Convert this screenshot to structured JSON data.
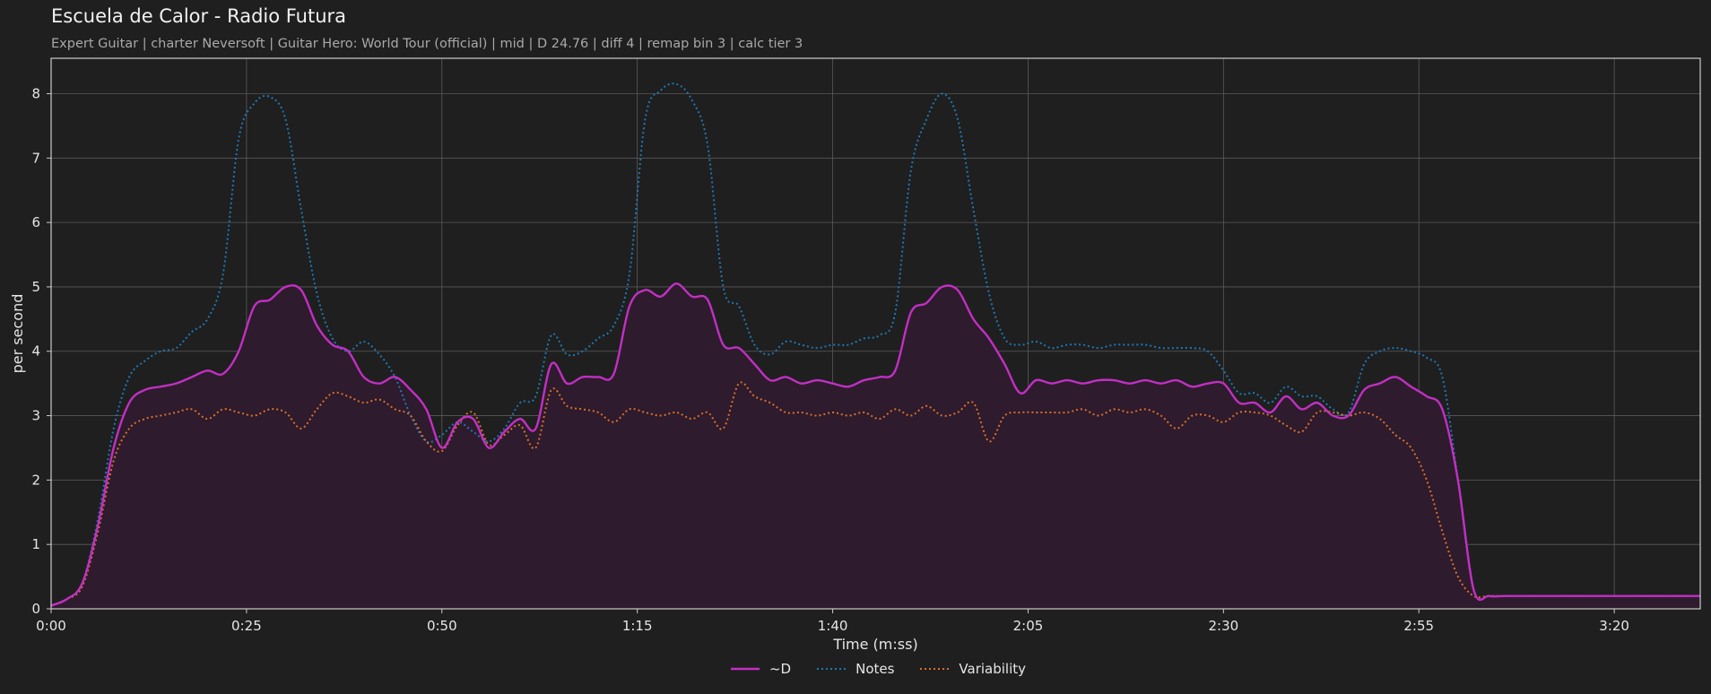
{
  "title": "Escuela de Calor - Radio Futura",
  "subtitle": "Expert Guitar  |  charter Neversoft  |  Guitar Hero: World Tour (official)  |  mid  |  D 24.76  |  diff 4  |  remap bin 3  |  calc tier 3",
  "colors": {
    "background": "#1f1f1f",
    "plot_border": "#cccccc",
    "grid": "#5a5a5a",
    "d_line": "#c22fc4",
    "d_fill": "#2e1b2d",
    "notes": "#1f77b4",
    "variability": "#d9702a"
  },
  "chart_data": {
    "type": "line",
    "xlabel": "Time (m:ss)",
    "ylabel": "per second",
    "xlim": [
      0,
      211
    ],
    "ylim": [
      0,
      8.55
    ],
    "x_ticks": [
      {
        "value": 0,
        "label": "0:00"
      },
      {
        "value": 25,
        "label": "0:25"
      },
      {
        "value": 50,
        "label": "0:50"
      },
      {
        "value": 75,
        "label": "1:15"
      },
      {
        "value": 100,
        "label": "1:40"
      },
      {
        "value": 125,
        "label": "2:05"
      },
      {
        "value": 150,
        "label": "2:30"
      },
      {
        "value": 175,
        "label": "2:55"
      },
      {
        "value": 200,
        "label": "3:20"
      }
    ],
    "y_ticks": [
      {
        "value": 0,
        "label": "0"
      },
      {
        "value": 1,
        "label": "1"
      },
      {
        "value": 2,
        "label": "2"
      },
      {
        "value": 3,
        "label": "3"
      },
      {
        "value": 4,
        "label": "4"
      },
      {
        "value": 5,
        "label": "5"
      },
      {
        "value": 6,
        "label": "6"
      },
      {
        "value": 7,
        "label": "7"
      },
      {
        "value": 8,
        "label": "8"
      }
    ],
    "grid": true,
    "legend_position": "bottom-center",
    "series": [
      {
        "name": "~D",
        "style": "solid",
        "filled": true,
        "x": [
          0,
          2,
          4,
          6,
          8,
          10,
          12,
          14,
          16,
          18,
          20,
          22,
          24,
          26,
          28,
          30,
          32,
          34,
          36,
          38,
          40,
          42,
          44,
          46,
          48,
          50,
          52,
          54,
          56,
          58,
          60,
          62,
          64,
          66,
          68,
          70,
          72,
          74,
          76,
          78,
          80,
          82,
          84,
          86,
          88,
          90,
          92,
          94,
          96,
          98,
          100,
          102,
          104,
          106,
          108,
          110,
          112,
          114,
          116,
          118,
          120,
          122,
          124,
          126,
          128,
          130,
          132,
          134,
          136,
          138,
          140,
          142,
          144,
          146,
          148,
          150,
          152,
          154,
          156,
          158,
          160,
          162,
          164,
          166,
          168,
          170,
          172,
          174,
          176,
          178,
          180,
          182,
          184,
          186,
          188,
          190,
          192,
          194,
          196,
          198,
          200,
          202,
          204,
          206,
          208,
          210,
          211
        ],
        "values": [
          0.05,
          0.15,
          0.4,
          1.3,
          2.5,
          3.2,
          3.4,
          3.45,
          3.5,
          3.6,
          3.7,
          3.65,
          4.0,
          4.7,
          4.8,
          5.0,
          4.95,
          4.4,
          4.1,
          4.0,
          3.6,
          3.5,
          3.6,
          3.4,
          3.1,
          2.5,
          2.9,
          2.95,
          2.5,
          2.75,
          2.95,
          2.8,
          3.8,
          3.5,
          3.6,
          3.6,
          3.65,
          4.7,
          4.95,
          4.85,
          5.05,
          4.85,
          4.8,
          4.1,
          4.05,
          3.8,
          3.55,
          3.6,
          3.5,
          3.55,
          3.5,
          3.45,
          3.55,
          3.6,
          3.7,
          4.6,
          4.75,
          5.0,
          4.95,
          4.5,
          4.2,
          3.8,
          3.35,
          3.55,
          3.5,
          3.55,
          3.5,
          3.55,
          3.55,
          3.5,
          3.55,
          3.5,
          3.55,
          3.45,
          3.5,
          3.5,
          3.2,
          3.2,
          3.05,
          3.3,
          3.1,
          3.2,
          3.0,
          3.0,
          3.4,
          3.5,
          3.6,
          3.45,
          3.3,
          3.1,
          2.0,
          0.3,
          0.2,
          0.2,
          0.2,
          0.2,
          0.2,
          0.2,
          0.2,
          0.2,
          0.2,
          0.2,
          0.2,
          0.2,
          0.2,
          0.2,
          0.2
        ]
      },
      {
        "name": "Notes",
        "style": "dotted",
        "filled": false,
        "x": [
          0,
          2,
          4,
          6,
          8,
          10,
          12,
          14,
          16,
          18,
          20,
          22,
          24,
          26,
          28,
          30,
          32,
          34,
          36,
          38,
          40,
          42,
          44,
          46,
          48,
          50,
          52,
          54,
          56,
          58,
          60,
          62,
          64,
          66,
          68,
          70,
          72,
          74,
          76,
          78,
          80,
          82,
          84,
          86,
          88,
          90,
          92,
          94,
          96,
          98,
          100,
          102,
          104,
          106,
          108,
          110,
          112,
          114,
          116,
          118,
          120,
          122,
          124,
          126,
          128,
          130,
          132,
          134,
          136,
          138,
          140,
          142,
          144,
          146,
          148,
          150,
          152,
          154,
          156,
          158,
          160,
          162,
          164,
          166,
          168,
          170,
          172,
          174,
          176,
          178,
          180,
          182,
          184,
          186,
          188,
          190,
          192,
          194,
          196,
          198,
          200,
          202,
          204,
          206,
          208,
          210,
          211
        ],
        "values": [
          0.05,
          0.15,
          0.4,
          1.4,
          2.8,
          3.6,
          3.85,
          4.0,
          4.05,
          4.3,
          4.5,
          5.2,
          7.3,
          7.85,
          7.95,
          7.6,
          6.2,
          4.9,
          4.2,
          4.0,
          4.15,
          3.95,
          3.6,
          3.0,
          2.6,
          2.7,
          2.9,
          2.75,
          2.6,
          2.8,
          3.2,
          3.3,
          4.25,
          3.95,
          4.0,
          4.2,
          4.4,
          5.2,
          7.6,
          8.05,
          8.15,
          7.9,
          7.2,
          5.0,
          4.7,
          4.1,
          3.95,
          4.15,
          4.1,
          4.05,
          4.1,
          4.1,
          4.2,
          4.25,
          4.6,
          6.8,
          7.6,
          8.0,
          7.6,
          6.2,
          4.9,
          4.2,
          4.1,
          4.15,
          4.05,
          4.1,
          4.1,
          4.05,
          4.1,
          4.1,
          4.1,
          4.05,
          4.05,
          4.05,
          4.0,
          3.7,
          3.35,
          3.35,
          3.2,
          3.45,
          3.3,
          3.3,
          3.1,
          3.05,
          3.8,
          4.0,
          4.05,
          4.0,
          3.9,
          3.6,
          2.0,
          0.3,
          0.2,
          0.2,
          0.2,
          0.2,
          0.2,
          0.2,
          0.2,
          0.2,
          0.2,
          0.2,
          0.2,
          0.2,
          0.2,
          0.2,
          0.2
        ]
      },
      {
        "name": "Variability",
        "style": "dotted",
        "filled": false,
        "x": [
          0,
          2,
          4,
          6,
          8,
          10,
          12,
          14,
          16,
          18,
          20,
          22,
          24,
          26,
          28,
          30,
          32,
          34,
          36,
          38,
          40,
          42,
          44,
          46,
          48,
          50,
          52,
          54,
          56,
          58,
          60,
          62,
          64,
          66,
          68,
          70,
          72,
          74,
          76,
          78,
          80,
          82,
          84,
          86,
          88,
          90,
          92,
          94,
          96,
          98,
          100,
          102,
          104,
          106,
          108,
          110,
          112,
          114,
          116,
          118,
          120,
          122,
          124,
          126,
          128,
          130,
          132,
          134,
          136,
          138,
          140,
          142,
          144,
          146,
          148,
          150,
          152,
          154,
          156,
          158,
          160,
          162,
          164,
          166,
          168,
          170,
          172,
          174,
          176,
          178,
          180,
          182,
          184,
          186,
          188,
          190,
          192,
          194,
          196,
          198,
          200,
          202,
          204,
          206,
          208,
          210,
          211
        ],
        "values": [
          0.05,
          0.15,
          0.35,
          1.2,
          2.3,
          2.8,
          2.95,
          3.0,
          3.05,
          3.1,
          2.95,
          3.1,
          3.05,
          3.0,
          3.1,
          3.05,
          2.8,
          3.1,
          3.35,
          3.3,
          3.2,
          3.25,
          3.1,
          3.0,
          2.6,
          2.45,
          2.85,
          3.05,
          2.55,
          2.7,
          2.85,
          2.5,
          3.4,
          3.15,
          3.1,
          3.05,
          2.9,
          3.1,
          3.05,
          3.0,
          3.05,
          2.95,
          3.05,
          2.8,
          3.5,
          3.3,
          3.2,
          3.05,
          3.05,
          3.0,
          3.05,
          3.0,
          3.05,
          2.95,
          3.1,
          3.0,
          3.15,
          3.0,
          3.05,
          3.2,
          2.6,
          3.0,
          3.05,
          3.05,
          3.05,
          3.05,
          3.1,
          3.0,
          3.1,
          3.05,
          3.1,
          3.0,
          2.8,
          3.0,
          3.0,
          2.9,
          3.05,
          3.05,
          3.0,
          2.85,
          2.75,
          3.05,
          3.05,
          3.0,
          3.05,
          2.95,
          2.7,
          2.5,
          2.0,
          1.2,
          0.5,
          0.2,
          0.2,
          0.2,
          0.2,
          0.2,
          0.2,
          0.2,
          0.2,
          0.2,
          0.2,
          0.2,
          0.2,
          0.2,
          0.2,
          0.2,
          0.2
        ]
      }
    ]
  }
}
